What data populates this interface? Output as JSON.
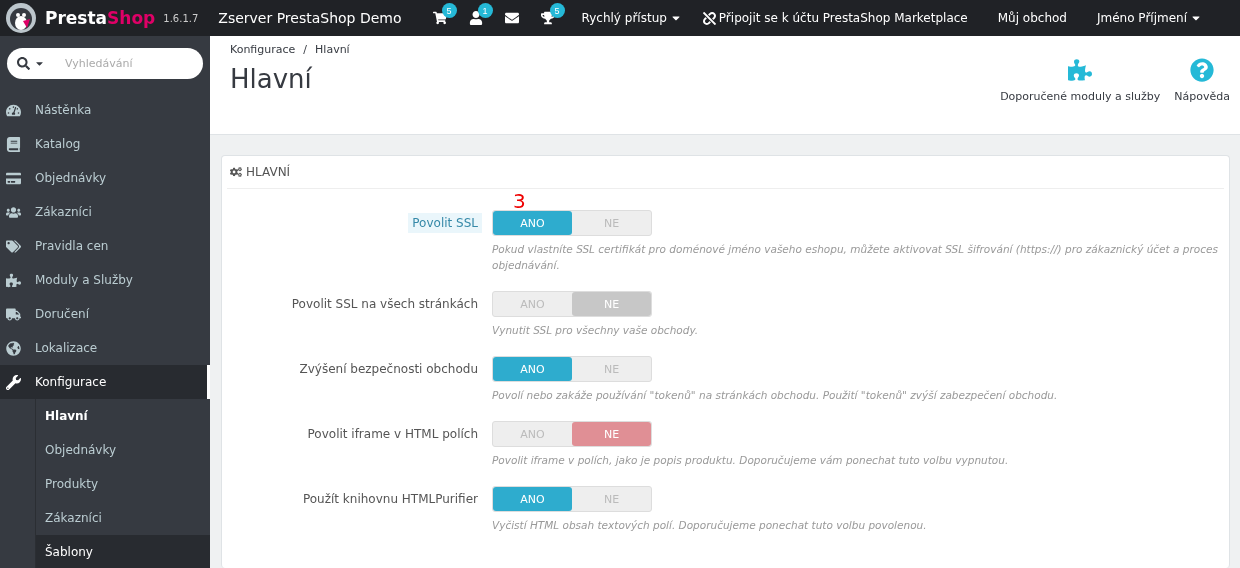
{
  "header": {
    "brand_prefix": "Presta",
    "brand_suffix": "Shop",
    "version": "1.6.1.7",
    "shop_name": "Zserver PrestaShop Demo",
    "notifications": [
      {
        "kind": "cart",
        "count": "5"
      },
      {
        "kind": "customer",
        "count": "1"
      },
      {
        "kind": "message"
      },
      {
        "kind": "trophy",
        "count": "5"
      }
    ],
    "quick_access": "Rychlý přístup",
    "marketplace": "Připojit se k účtu PrestaShop Marketplace",
    "my_shop": "Můj obchod",
    "user": "Jméno Příjmení"
  },
  "sidebar": {
    "search": {
      "placeholder": "Vyhledávání"
    },
    "items": [
      {
        "kind": "dashboard",
        "label": "Nástěnka",
        "selected": false
      },
      {
        "kind": "catalog",
        "label": "Katalog",
        "selected": false
      },
      {
        "kind": "orders",
        "label": "Objednávky",
        "selected": false
      },
      {
        "kind": "customers",
        "label": "Zákazníci",
        "selected": false
      },
      {
        "kind": "price_rules",
        "label": "Pravidla cen",
        "selected": false
      },
      {
        "kind": "modules",
        "label": "Moduly a Služby",
        "selected": false
      },
      {
        "kind": "shipping",
        "label": "Doručení",
        "selected": false
      },
      {
        "kind": "localization",
        "label": "Lokalizace",
        "selected": false
      },
      {
        "kind": "configuration",
        "label": "Konfigurace",
        "selected": true,
        "children": [
          {
            "label": "Hlavní",
            "selected": true,
            "hovered": false
          },
          {
            "label": "Objednávky",
            "selected": false,
            "hovered": false
          },
          {
            "label": "Produkty",
            "selected": false,
            "hovered": false
          },
          {
            "label": "Zákazníci",
            "selected": false,
            "hovered": false
          },
          {
            "label": "Šablony",
            "selected": false,
            "hovered": true
          }
        ]
      }
    ]
  },
  "page_head": {
    "breadcrumb": [
      "Konfigurace",
      "Hlavní"
    ],
    "breadcrumb_separator": "/",
    "title": "Hlavní",
    "toolbar": [
      {
        "kind": "modules",
        "label": "Doporučené moduly a služby"
      },
      {
        "kind": "help",
        "label": "Nápověda"
      }
    ]
  },
  "panel": {
    "title": "HLAVNÍ",
    "annotation": "3",
    "settings": [
      {
        "label": "Povolit SSL",
        "highlighted": true,
        "options": [
          {
            "label": "ANO",
            "selected": true
          },
          {
            "label": "NE",
            "selected": false
          }
        ],
        "help": "Pokud vlastníte SSL certifikát pro doménové jméno vašeho eshopu, můžete aktivovat SSL šifrování (https://) pro zákaznický účet a proces objednávání."
      },
      {
        "label": "Povolit SSL na všech stránkách",
        "highlighted": false,
        "options": [
          {
            "label": "ANO",
            "selected": false
          },
          {
            "label": "NE",
            "selected": true
          }
        ],
        "help": "Vynutit SSL pro všechny vaše obchody."
      },
      {
        "label": "Zvýšení bezpečnosti obchodu",
        "highlighted": false,
        "options": [
          {
            "label": "ANO",
            "selected": true
          },
          {
            "label": "NE",
            "selected": false
          }
        ],
        "help": "Povolí nebo zakáže používání \"tokenů\" na stránkách obchodu. Použití \"tokenů\" zvýší zabezpečení obchodu."
      },
      {
        "label": "Povolit iframe v HTML polích",
        "highlighted": false,
        "warning": true,
        "options": [
          {
            "label": "ANO",
            "selected": false
          },
          {
            "label": "NE",
            "selected": true
          }
        ],
        "help": "Povolit iframe v polích, jako je popis produktu. Doporučujeme vám ponechat tuto volbu vypnutou."
      },
      {
        "label": "Použít knihovnu HTMLPurifier",
        "highlighted": false,
        "options": [
          {
            "label": "ANO",
            "selected": true
          },
          {
            "label": "NE",
            "selected": false
          }
        ],
        "help": "Vyčistí HTML obsah textových polí. Doporučujeme ponechat tuto volbu povolenou."
      }
    ]
  }
}
